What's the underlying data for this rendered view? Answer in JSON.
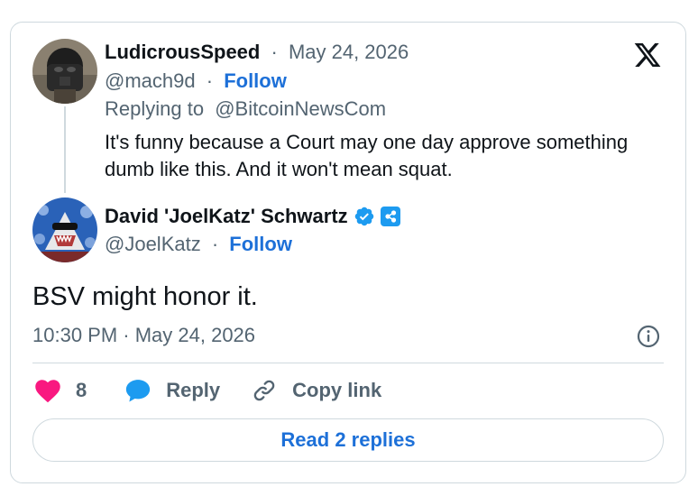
{
  "parent": {
    "display_name": "LudicrousSpeed",
    "separator": "·",
    "date": "May 24, 2026",
    "handle": "@mach9d",
    "follow_label": "Follow",
    "replying_prefix": "Replying to",
    "replying_handle": "@BitcoinNewsCom",
    "text": "It's funny because a Court may one day approve something dumb like this. And it won't mean squat."
  },
  "tweet": {
    "display_name": "David 'JoelKatz' Schwartz",
    "handle": "@JoelKatz",
    "separator": "·",
    "follow_label": "Follow",
    "text": "BSV might honor it.",
    "timestamp": "10:30 PM · May 24, 2026"
  },
  "actions": {
    "like_count": "8",
    "reply_label": "Reply",
    "copy_link_label": "Copy link"
  },
  "read_replies_label": "Read 2 replies",
  "colors": {
    "follow_blue": "#1d70d8",
    "like_red": "#f91880",
    "reply_blue": "#1d9bf0",
    "verified_blue": "#1d9bf0",
    "muted_text": "#536471",
    "border": "#cfd9de"
  },
  "icons": [
    "x-logo-icon",
    "verified-badge-icon",
    "affiliate-badge-icon",
    "info-icon",
    "heart-icon",
    "reply-bubble-icon",
    "link-icon"
  ]
}
